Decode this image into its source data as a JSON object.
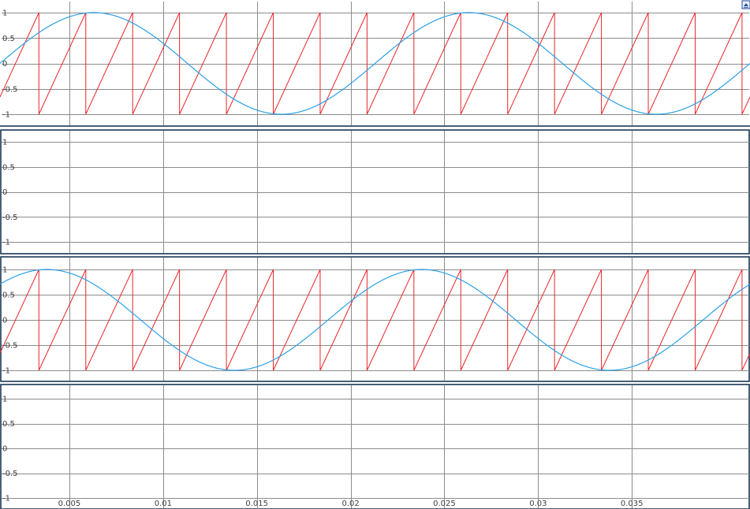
{
  "chart_data": {
    "type": "line",
    "x_ticks": [
      0.005,
      0.01,
      0.015,
      0.02,
      0.025,
      0.03,
      0.035
    ],
    "x_tick_labels": [
      "0.005",
      "0.01",
      "0.015",
      "0.02",
      "0.025",
      "0.03",
      "0.035"
    ],
    "xlim": [
      0.0013,
      0.0413
    ],
    "ylim": [
      -1,
      1
    ],
    "y_ticks": [
      1,
      0.5,
      0,
      -0.5,
      -1
    ],
    "y_tick_labels": [
      "1",
      "0.5",
      "0",
      "-0.5",
      "-1"
    ],
    "grid": true,
    "panels": [
      {
        "series": [
          {
            "kind": "sawtooth",
            "period": 0.0025,
            "phase": 0.000875,
            "amplitude": 1,
            "color": "#e8262a"
          },
          {
            "kind": "sine",
            "frequency": 50,
            "phase_time": 0.0013,
            "amplitude": 1,
            "color": "#2aa1e6"
          }
        ]
      },
      {
        "series": []
      },
      {
        "series": [
          {
            "kind": "sawtooth",
            "period": 0.0025,
            "phase": 0.000875,
            "amplitude": 1,
            "color": "#e8262a"
          },
          {
            "kind": "sine",
            "frequency": 50,
            "phase_time": -0.0012,
            "amplitude": 1,
            "color": "#2aa1e6"
          }
        ]
      },
      {
        "series": []
      }
    ]
  },
  "colors": {
    "grid": "#8c8c8c",
    "border": "#0b2a4a",
    "sawtooth": "#e8262a",
    "sine": "#2aa1e6"
  },
  "icons": {
    "corner_button": "autoscale-icon"
  }
}
